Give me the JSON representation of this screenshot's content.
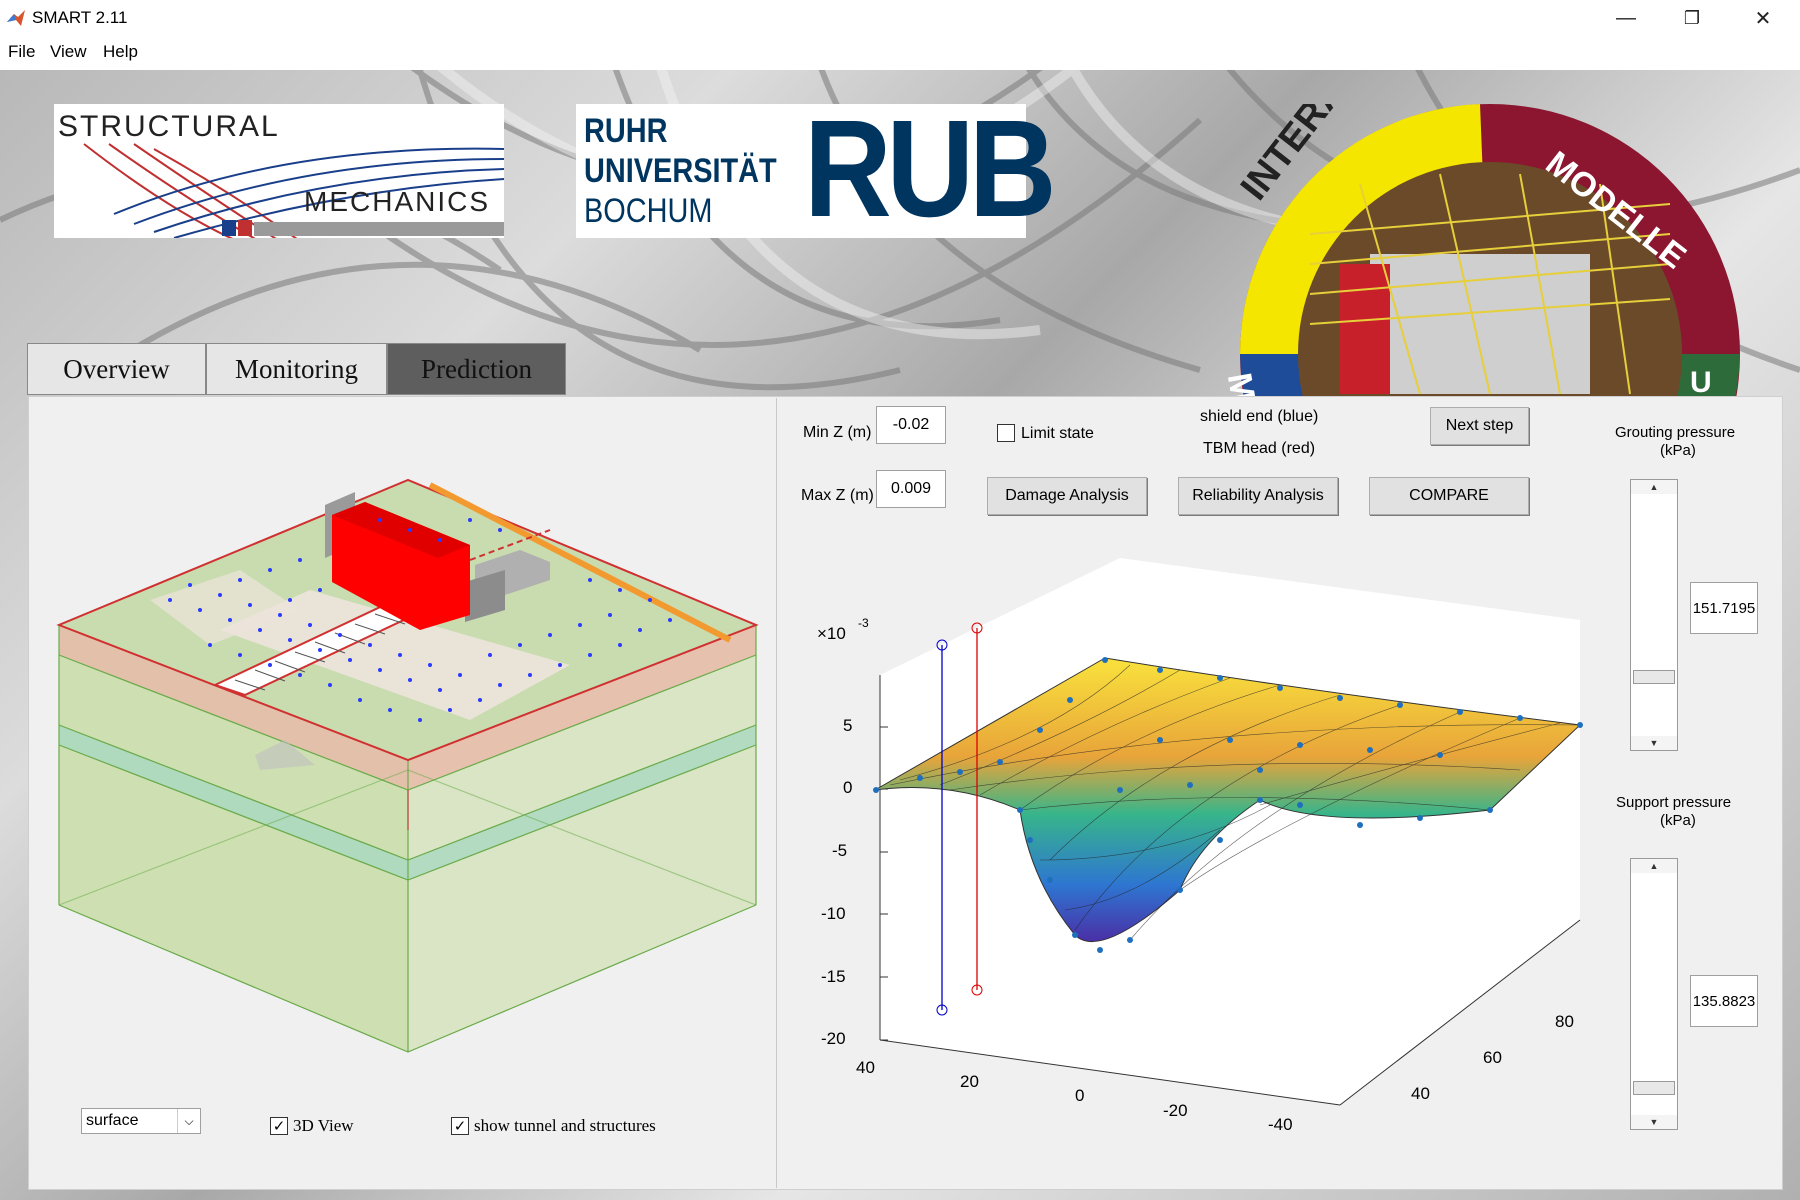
{
  "window": {
    "title": "SMART 2.11",
    "minimize": "—",
    "maximize": "❐",
    "close": "✕"
  },
  "menu": {
    "file": "File",
    "view": "View",
    "help": "Help"
  },
  "logos": {
    "structural_top": "STRUCTURAL",
    "structural_bottom": "MECHANICS",
    "rub_line1": "RUHR",
    "rub_line2": "UNIVERSITÄT",
    "rub_line3": "BOCHUM",
    "rub_mark": "RUB",
    "circle_top": "INTERAKTIONS-",
    "circle_right": "MODELLE",
    "circle_left": "MA",
    "circle_bottom_right": "U"
  },
  "tabs": [
    {
      "label": "Overview"
    },
    {
      "label": "Monitoring"
    },
    {
      "label": "Prediction"
    }
  ],
  "controls": {
    "min_z_label": "Min Z (m)",
    "min_z_value": "-0.02",
    "max_z_label": "Max Z (m)",
    "max_z_value": "0.009",
    "limit_state": "Limit state",
    "shield_end": "shield end (blue)",
    "tbm_head": "TBM head (red)",
    "next_step": "Next step",
    "damage_analysis": "Damage Analysis",
    "reliability_analysis": "Reliability Analysis",
    "compare": "COMPARE",
    "grouting_label_1": "Grouting pressure",
    "grouting_label_2": "(kPa)",
    "grouting_value": "151.7195",
    "support_label_1": "Support pressure",
    "support_label_2": "(kPa)",
    "support_value": "135.8823",
    "view_select": "surface",
    "view3d": "3D View",
    "show_tunnel": "show tunnel and structures"
  },
  "plot": {
    "exponent_base": "×10",
    "exponent": "-3",
    "z_ticks": [
      "5",
      "0",
      "-5",
      "-10",
      "-15",
      "-20"
    ],
    "x_ticks": [
      "40",
      "20",
      "0",
      "-20",
      "-40"
    ],
    "y_ticks": [
      "40",
      "60",
      "80"
    ]
  },
  "colors": {
    "accent_red": "#ff0000",
    "accent_blue": "#0000cc",
    "rub_blue": "#003560"
  }
}
